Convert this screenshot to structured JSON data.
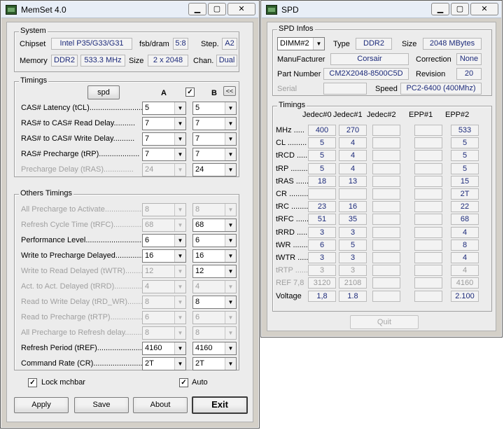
{
  "memset": {
    "title": "MemSet 4.0",
    "system": {
      "legend": "System",
      "chipset_label": "Chipset",
      "chipset": "Intel P35/G33/G31",
      "fsb_label": "fsb/dram",
      "fsb": "5:8",
      "step_label": "Step.",
      "step": "A2",
      "memory_label": "Memory",
      "mem_type": "DDR2",
      "mem_speed": "533.3 MHz",
      "size_label": "Size",
      "size": "2 x 2048",
      "chan_label": "Chan.",
      "chan": "Dual"
    },
    "timings": {
      "legend": "Timings",
      "spd_button": "spd",
      "col_a": "A",
      "col_b": "B",
      "sync_button": "<<",
      "rows": [
        {
          "label": "CAS# Latency (tCL).........................",
          "a": "5",
          "b": "5",
          "disabled": false
        },
        {
          "label": "RAS# to CAS# Read Delay..........",
          "a": "7",
          "b": "7",
          "disabled": false
        },
        {
          "label": "RAS# to CAS# Write Delay..........",
          "a": "7",
          "b": "7",
          "disabled": false
        },
        {
          "label": "RAS# Precharge (tRP)...................",
          "a": "7",
          "b": "7",
          "disabled": false
        },
        {
          "label": "Precharge Delay  (tRAS)..............",
          "a": "24",
          "b": "24",
          "disabled": true,
          "b_enabled": true
        }
      ]
    },
    "others": {
      "legend": "Others Timings",
      "rows": [
        {
          "label": "All Precharge to Activate...................",
          "a": "8",
          "b": "8",
          "disabled": true
        },
        {
          "label": "Refresh Cycle Time (tRFC)................",
          "a": "68",
          "b": "68",
          "disabled": true,
          "b_enabled": true
        },
        {
          "label": "Performance Level.............................",
          "a": "6",
          "b": "6",
          "disabled": false
        },
        {
          "label": "Write to Precharge Delayed..............",
          "a": "16",
          "b": "16",
          "disabled": false
        },
        {
          "label": "Write to Read Delayed (tWTR)............",
          "a": "12",
          "b": "12",
          "disabled": true,
          "b_enabled": true
        },
        {
          "label": "Act. to Act. Delayed (tRRD)..............",
          "a": "4",
          "b": "4",
          "disabled": true
        },
        {
          "label": "Read to Write Delay (tRD_WR)...........",
          "a": "8",
          "b": "8",
          "disabled": true,
          "b_enabled": true
        },
        {
          "label": "Read to Precharge (tRTP)..................",
          "a": "6",
          "b": "6",
          "disabled": true
        },
        {
          "label": "All Precharge to Refresh delay............",
          "a": "8",
          "b": "8",
          "disabled": true
        },
        {
          "label": "Refresh Period (tREF)......................",
          "a": "4160",
          "b": "4160",
          "disabled": false
        },
        {
          "label": "Command Rate (CR)..........................",
          "a": "2T",
          "b": "2T",
          "disabled": false
        }
      ]
    },
    "lock_mchbar": "Lock mchbar",
    "auto": "Auto",
    "buttons": {
      "apply": "Apply",
      "save": "Save",
      "about": "About",
      "exit": "Exit"
    }
  },
  "spd": {
    "title": "SPD",
    "infos": {
      "legend": "SPD Infos",
      "dimm": "DIMM#2",
      "type_label": "Type",
      "type": "DDR2",
      "size_label": "Size",
      "size": "2048 MBytes",
      "mfr_label": "ManuFacturer",
      "mfr": "Corsair",
      "corr_label": "Correction",
      "corr": "None",
      "part_label": "Part Number",
      "part": "CM2X2048-8500C5D",
      "rev_label": "Revision",
      "rev": "20",
      "serial_label": "Serial",
      "serial": "",
      "speed_label": "Speed",
      "speed": "PC2-6400 (400Mhz)"
    },
    "timings": {
      "legend": "Timings",
      "columns": [
        "Jedec#0",
        "Jedec#1",
        "Jedec#2",
        "EPP#1",
        "EPP#2"
      ],
      "rows": [
        {
          "label": "MHz .....",
          "values": [
            "400",
            "270",
            "",
            "",
            "533"
          ]
        },
        {
          "label": "CL .........",
          "values": [
            "5",
            "4",
            "",
            "",
            "5"
          ]
        },
        {
          "label": "tRCD .......",
          "values": [
            "5",
            "4",
            "",
            "",
            "5"
          ]
        },
        {
          "label": "tRP .........",
          "values": [
            "5",
            "4",
            "",
            "",
            "5"
          ]
        },
        {
          "label": "tRAS .......",
          "values": [
            "18",
            "13",
            "",
            "",
            "15"
          ]
        },
        {
          "label": "CR ..........",
          "values": [
            "",
            "",
            "",
            "",
            "2T"
          ]
        },
        {
          "label": "tRC .........",
          "values": [
            "23",
            "16",
            "",
            "",
            "22"
          ]
        },
        {
          "label": "tRFC ........",
          "values": [
            "51",
            "35",
            "",
            "",
            "68"
          ]
        },
        {
          "label": "tRRD .......",
          "values": [
            "3",
            "3",
            "",
            "",
            "4"
          ]
        },
        {
          "label": "tWR .........",
          "values": [
            "6",
            "5",
            "",
            "",
            "8"
          ]
        },
        {
          "label": "tWTR .......",
          "values": [
            "3",
            "3",
            "",
            "",
            "4"
          ]
        },
        {
          "label": "tRTP .......",
          "values": [
            "3",
            "3",
            "",
            "",
            "4"
          ],
          "disabled": true
        },
        {
          "label": "REF 7,8",
          "values": [
            "3120",
            "2108",
            "",
            "",
            "4160"
          ],
          "disabled": true
        },
        {
          "label": "Voltage",
          "values": [
            "1,8",
            "1.8",
            "",
            "",
            "2.100"
          ]
        }
      ]
    },
    "quit": "Quit"
  }
}
